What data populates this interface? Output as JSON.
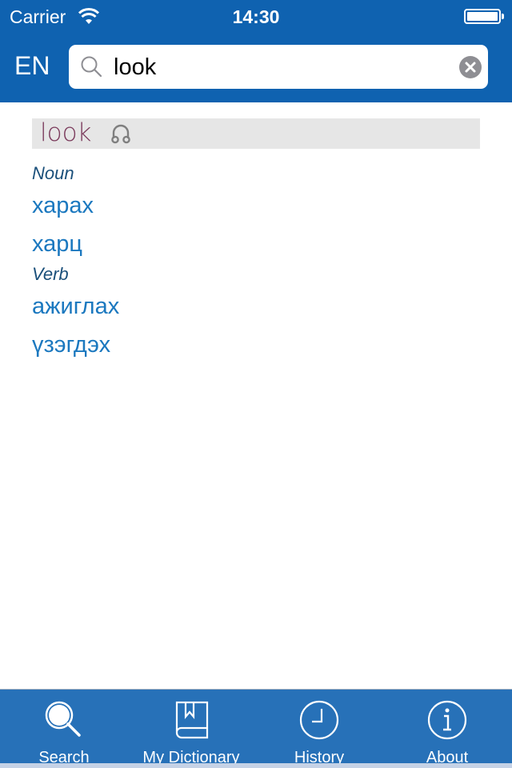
{
  "status_bar": {
    "carrier": "Carrier",
    "time": "14:30",
    "battery_level": 1.0
  },
  "header": {
    "language": "EN",
    "search": {
      "value": "look",
      "placeholder": ""
    }
  },
  "entry": {
    "headword": "look",
    "sections": [
      {
        "pos": "Noun",
        "translations": [
          "харах",
          "харц"
        ]
      },
      {
        "pos": "Verb",
        "translations": [
          "ажиглах",
          "үзэгдэх"
        ]
      }
    ]
  },
  "tabbar": {
    "items": [
      {
        "label": "Search",
        "icon": "search-icon"
      },
      {
        "label": "My Dictionary",
        "icon": "book-bookmark-icon"
      },
      {
        "label": "History",
        "icon": "clock-icon"
      },
      {
        "label": "About",
        "icon": "info-icon"
      }
    ]
  },
  "colors": {
    "header_bg": "#0f62b0",
    "tabbar_bg": "#2771b8",
    "headword": "#7b3b5c",
    "pos": "#1a4f7a",
    "translation": "#1b78bf"
  }
}
